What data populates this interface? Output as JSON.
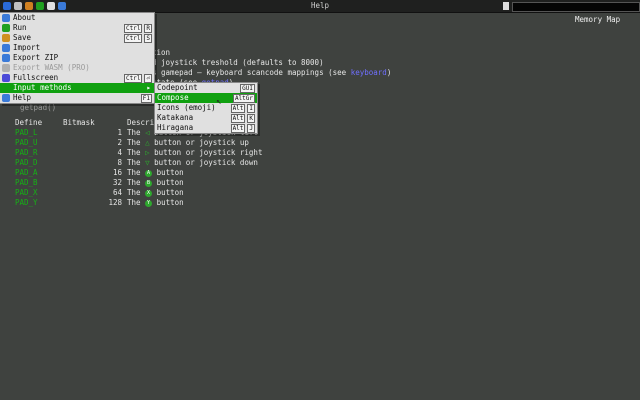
{
  "window": {
    "title": "Help"
  },
  "toolbar_icons": [
    "app-menu-icon",
    "paint-icon",
    "character-icon",
    "font-icon",
    "music-icon",
    "code-icon"
  ],
  "header": {
    "memory_map": "Memory Map"
  },
  "doc_lines": [
    {
      "text": "tion"
    },
    {
      "text": "d joystick treshold (defaults to 8000)"
    },
    {
      "before": "s gamepad — keyboard scancode mappings (see ",
      "link": "keyboard",
      "after": ")"
    },
    {
      "before": "state (see ",
      "link": "getpad",
      "after": ")"
    }
  ],
  "table": {
    "headers": [
      "Define",
      "Bitmask",
      "Descri"
    ],
    "rows": [
      {
        "define": "PAD_L",
        "bitmask": "1",
        "desc_pre": "The",
        "desc": "button or joystick left",
        "icon": "left-arrow-icon",
        "glyph": "◁"
      },
      {
        "define": "PAD_U",
        "bitmask": "2",
        "desc_pre": "The",
        "desc": "button or joystick up",
        "icon": "up-arrow-icon",
        "glyph": "△"
      },
      {
        "define": "PAD_R",
        "bitmask": "4",
        "desc_pre": "The",
        "desc": "button or joystick right",
        "icon": "right-arrow-icon",
        "glyph": "▷"
      },
      {
        "define": "PAD_D",
        "bitmask": "8",
        "desc_pre": "The",
        "desc": "button or joystick down",
        "icon": "down-arrow-icon",
        "glyph": "▽"
      },
      {
        "define": "PAD_A",
        "bitmask": "16",
        "desc_pre": "The",
        "desc": "button",
        "icon": "a-button-icon",
        "glyph": "A"
      },
      {
        "define": "PAD_B",
        "bitmask": "32",
        "desc_pre": "The",
        "desc": "button",
        "icon": "b-button-icon",
        "glyph": "B"
      },
      {
        "define": "PAD_X",
        "bitmask": "64",
        "desc_pre": "The",
        "desc": "button",
        "icon": "x-button-icon",
        "glyph": "X"
      },
      {
        "define": "PAD_Y",
        "bitmask": "128",
        "desc_pre": "The",
        "desc": "button",
        "icon": "y-button-icon",
        "glyph": "Y"
      }
    ]
  },
  "main_menu": [
    {
      "label": "About",
      "icon": "about-icon",
      "color": "#3a7ad8"
    },
    {
      "label": "Run",
      "icon": "run-icon",
      "color": "#20a020",
      "shortcut": [
        "Ctrl",
        "R"
      ]
    },
    {
      "label": "Save",
      "icon": "save-icon",
      "color": "#d09020",
      "shortcut": [
        "Ctrl",
        "S"
      ]
    },
    {
      "label": "Import",
      "icon": "import-icon",
      "color": "#3a7ad8"
    },
    {
      "label": "Export ZIP",
      "icon": "export-zip-icon",
      "color": "#3a7ad8"
    },
    {
      "label": "Export WASM (PRO)",
      "icon": "export-wasm-icon",
      "color": "#b0b0b0",
      "disabled": true
    },
    {
      "label": "Fullscreen",
      "icon": "fullscreen-icon",
      "color": "#4a4ad8",
      "shortcut": [
        "Ctrl",
        "⏎"
      ]
    },
    {
      "label": "Input methods",
      "icon": "input-methods-icon",
      "color": "#10a010",
      "submenu": true,
      "selected": true
    },
    {
      "label": "Help",
      "icon": "help-icon",
      "color": "#3a7ad8",
      "shortcut": [
        "F1"
      ]
    }
  ],
  "sub_menu": [
    {
      "label": "Codepoint",
      "shortcut": [
        "GUI"
      ]
    },
    {
      "label": "Compose",
      "shortcut": [
        "AltGr"
      ],
      "selected": true
    },
    {
      "label": "Icons (emoji)",
      "shortcut": [
        "Alt",
        "I"
      ]
    },
    {
      "label": "Katakana",
      "shortcut": [
        "Alt",
        "K"
      ]
    },
    {
      "label": "Hiragana",
      "shortcut": [
        "Alt",
        "J"
      ]
    }
  ],
  "obscured_text": "getpad()"
}
